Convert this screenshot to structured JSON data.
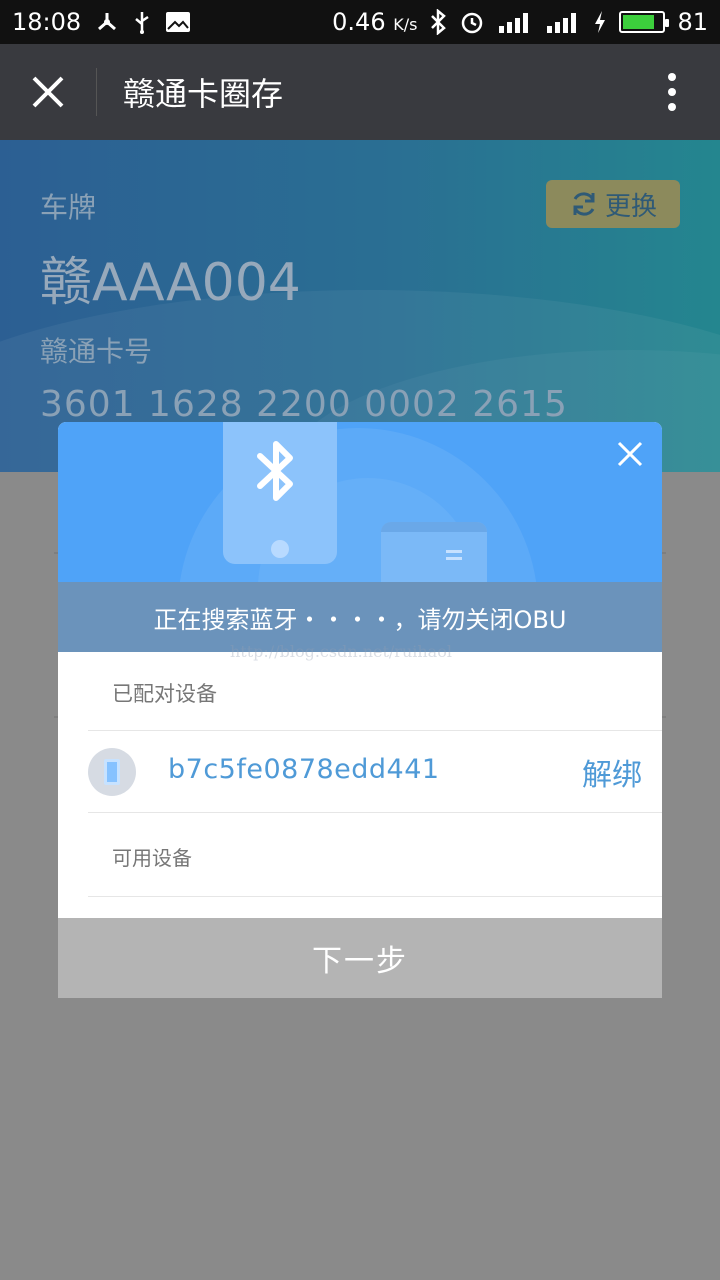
{
  "status_bar": {
    "time": "18:08",
    "net_speed": "0.46",
    "net_unit": "K/s",
    "battery_level": "81",
    "battery_fraction": 0.81,
    "battery_color": "#3ccf3c",
    "icons": [
      "share-icon",
      "usb-icon",
      "image-icon",
      "bluetooth-icon",
      "alarm-icon",
      "signal-4g-icon",
      "signal-icon",
      "charging-icon",
      "battery-icon"
    ]
  },
  "app_bar": {
    "title": "赣通卡圈存",
    "close_icon": "close-icon",
    "more_icon": "more-vertical-icon"
  },
  "card": {
    "plate_label": "车牌",
    "plate_value": "赣AAA004",
    "change_label": "更换",
    "card_no_label": "赣通卡号",
    "card_no_value": "3601 1628 2200 0002 2615"
  },
  "dialog": {
    "status_text": "正在搜索蓝牙・・・・，请勿关闭OBU",
    "paired_label": "已配对设备",
    "paired_devices": [
      {
        "name": "b7c5fe0878edd441",
        "action": "解绑"
      }
    ],
    "available_label": "可用设备",
    "next_label": "下一步",
    "accent_color": "#4fa3f8"
  },
  "watermark": "http://blog.csdn.net/ruihaol"
}
